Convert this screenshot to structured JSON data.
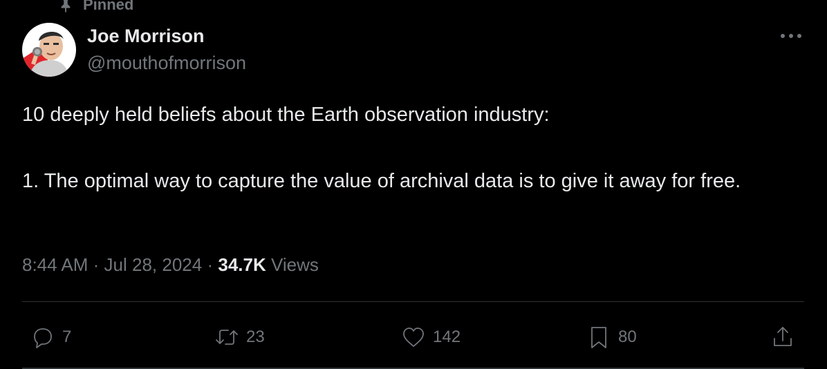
{
  "pinned": {
    "label": "Pinned",
    "icon": "pin-icon"
  },
  "author": {
    "name": "Joe Morrison",
    "handle": "@mouthofmorrison"
  },
  "tweet": {
    "line1": "10 deeply held beliefs about the Earth observation industry:",
    "line2": "1. The optimal way to capture the value of archival data is to give it away for free."
  },
  "meta": {
    "time": "8:44 AM",
    "separator": "·",
    "date": "Jul 28, 2024",
    "views_count": "34.7K",
    "views_label": "Views"
  },
  "actions": {
    "replies": "7",
    "reposts": "23",
    "likes": "142",
    "bookmarks": "80"
  },
  "colors": {
    "background": "#000000",
    "text": "#e7e9ea",
    "muted": "#71767b",
    "divider": "#2f3336"
  }
}
